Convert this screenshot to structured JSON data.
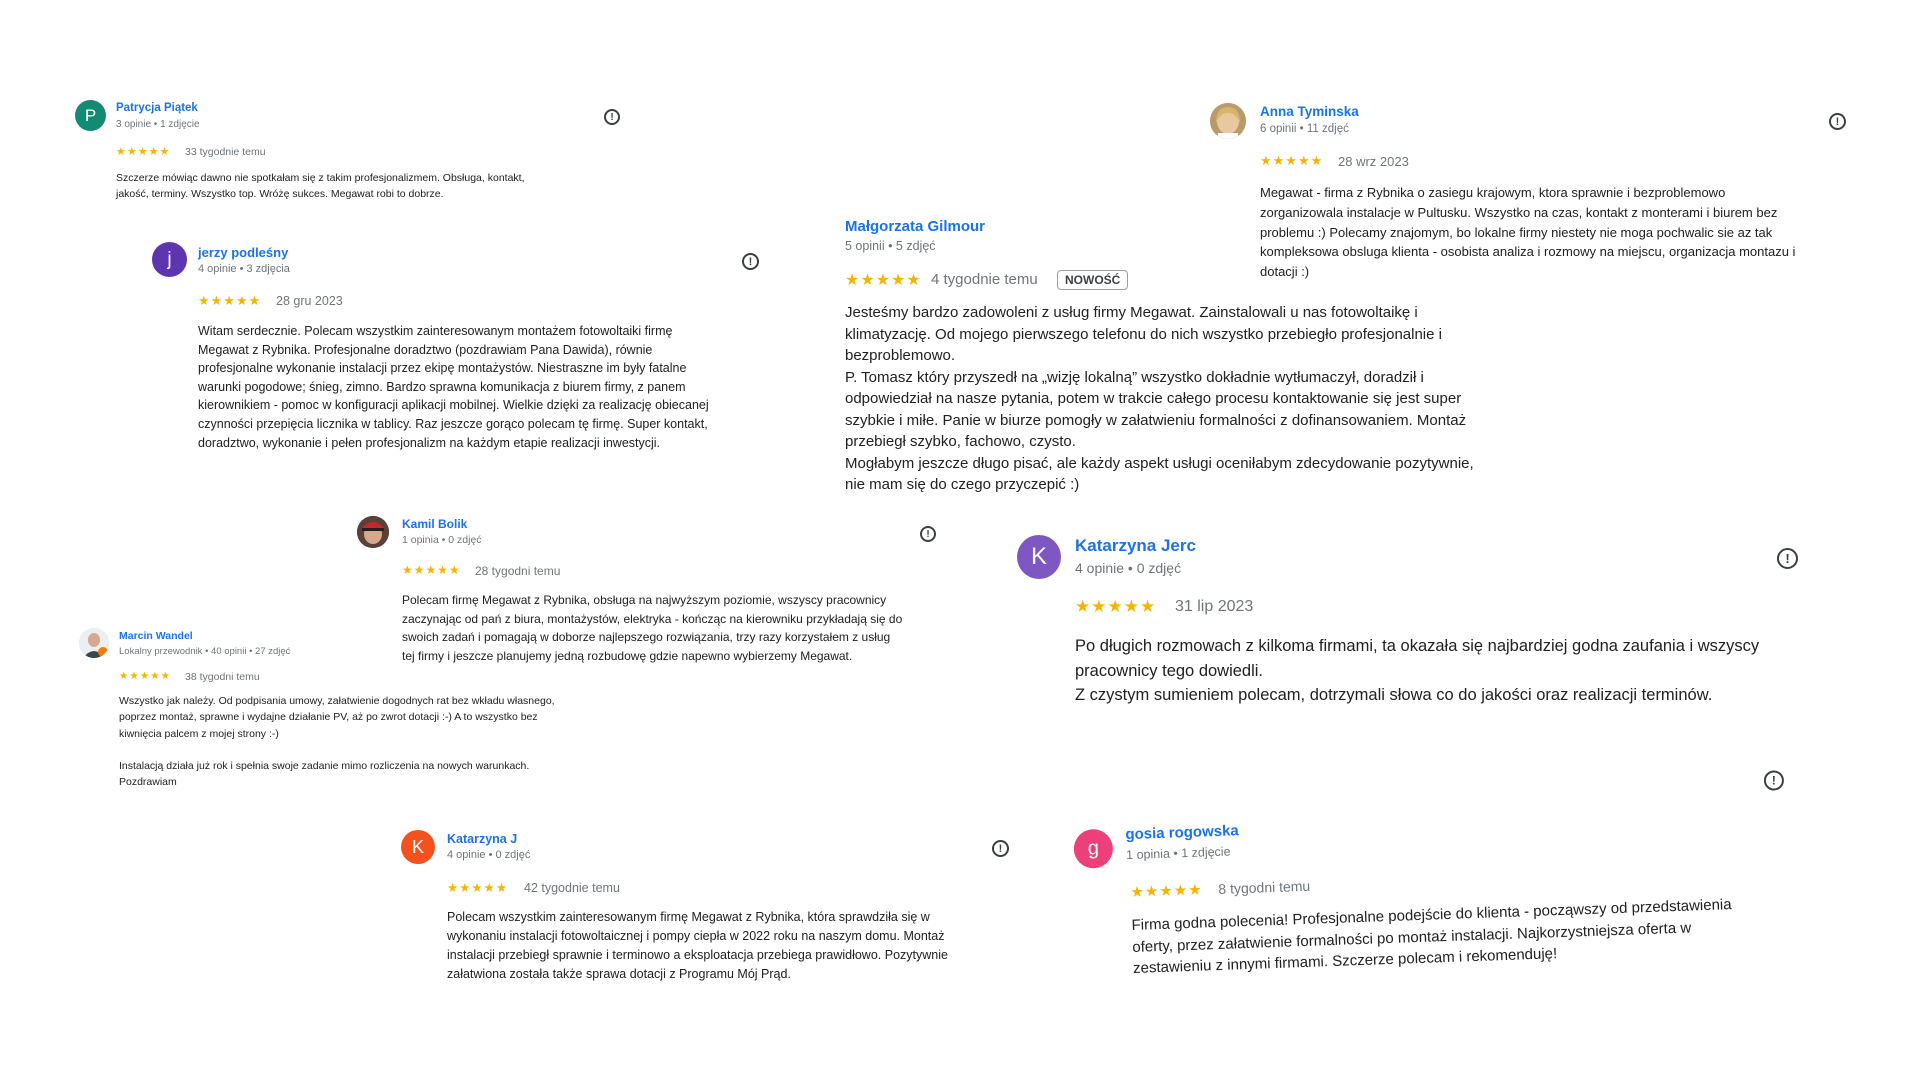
{
  "colors": {
    "link_name": "#1a73e8",
    "star": "#f5b400",
    "avatar_patrycja": "#138a74",
    "avatar_jerzy": "#5e35b1",
    "avatar_katarzyna_jerc": "#7e57c2",
    "avatar_katarzyna_j": "#f4511e",
    "avatar_gosia": "#ec407a"
  },
  "icons": {
    "report": "report-icon",
    "stars": "star-rating-icon"
  },
  "reviews": {
    "patrycja": {
      "initial": "P",
      "name": "Patrycja Piątek",
      "meta": "3 opinie • 1 zdjęcie",
      "rating": 5,
      "stars": "★★★★★",
      "date": "33 tygodnie temu",
      "text": "Szczerze mówiąc dawno nie spotkałam się z takim profesjonalizmem. Obsługa, kontakt,\njakość, terminy. Wszystko top. Wróżę sukces. Megawat robi to dobrze."
    },
    "jerzy": {
      "initial": "j",
      "name": "jerzy podleśny",
      "meta": "4 opinie • 3 zdjęcia",
      "rating": 5,
      "stars": "★★★★★",
      "date": "28 gru 2023",
      "text": "Witam serdecznie. Polecam wszystkim zainteresowanym montażem fotowoltaiki firmę\nMegawat z Rybnika. Profesjonalne doradztwo (pozdrawiam Pana Dawida), równie\nprofesjonalne wykonanie instalacji przez ekipę montażystów. Niestraszne im były fatalne\nwarunki pogodowe; śnieg, zimno. Bardzo sprawna komunikacja z biurem firmy, z panem\nkierownikiem - pomoc w konfiguracji aplikacji mobilnej. Wielkie dzięki za realizację obiecanej\nczynności przepięcia licznika w tablicy. Raz jeszcze gorąco polecam tę firmę. Super kontakt,\ndoradztwo, wykonanie i pełen profesjonalizm na każdym etapie realizacji inwestycji."
    },
    "malgorzata": {
      "name": "Małgorzata Gilmour",
      "meta": "5 opinii • 5 zdjęć",
      "rating": 5,
      "stars": "★★★★★",
      "date": "4 tygodnie temu",
      "badge": "NOWOŚĆ",
      "text": "Jesteśmy bardzo zadowoleni z usług firmy Megawat. Zainstalowali u nas fotowoltaikę i\nklimatyzację. Od mojego pierwszego telefonu do nich wszystko przebiegło profesjonalnie i\nbezproblemowo.\nP. Tomasz który przyszedł na „wizję lokalną” wszystko dokładnie wytłumaczył, doradził i\nodpowiedział na nasze pytania, potem w trakcie całego procesu kontaktowanie się jest super\nszybkie i miłe. Panie w biurze pomogły w załatwieniu formalności z dofinansowaniem. Montaż\nprzebiegł szybko, fachowo, czysto.\nMogłabym jeszcze długo pisać, ale każdy aspekt usługi oceniłabym zdecydowanie pozytywnie,\nnie mam się do czego przyczepić :)"
    },
    "anna": {
      "name": "Anna Tyminska",
      "meta": "6 opinii • 11 zdjęć",
      "rating": 5,
      "stars": "★★★★★",
      "date": "28 wrz 2023",
      "text": "Megawat - firma z Rybnika o zasiegu krajowym, ktora sprawnie i bezproblemowo\nzorganizowala instalacje w Pultusku. Wszystko na czas, kontakt z monterami i biurem bez\nproblemu :) Polecamy znajomym, bo lokalne firmy niestety nie moga pochwalic sie az tak\nkompleksowa obsluga klienta - osobista analiza i rozmowy na miejscu, organizacja montazu i\ndotacji :)"
    },
    "kamil": {
      "name": "Kamil Bolik",
      "meta": "1 opinia • 0 zdjęć",
      "rating": 5,
      "stars": "★★★★★",
      "date": "28 tygodni temu",
      "text": "Polecam firmę Megawat z Rybnika, obsługa na najwyższym poziomie, wszyscy pracownicy\nzaczynając od pań z biura, montażystów, elektryka - kończąc na kierowniku przykładają się do\nswoich zadań i pomagają w doborze najlepszego rozwiązania, trzy razy korzystałem z usług\ntej firmy i jeszcze planujemy jedną rozbudowę gdzie napewno wybierzemy Megawat."
    },
    "marcin": {
      "name": "Marcin Wandel",
      "meta": "Lokalny przewodnik • 40 opinii • 27 zdjęć",
      "rating": 5,
      "stars": "★★★★★",
      "date": "38 tygodni temu",
      "text": "Wszystko jak należy. Od podpisania umowy, załatwienie dogodnych rat bez wkładu własnego,\npoprzez montaż, sprawne i wydajne działanie PV, aż po zwrot dotacji :-) A to wszystko bez\nkiwnięcia palcem z mojej strony :-)\n\nInstalacją działa już rok i spełnia swoje zadanie mimo rozliczenia na nowych warunkach.\nPozdrawiam"
    },
    "katarzyna_jerc": {
      "initial": "K",
      "name": "Katarzyna Jerc",
      "meta": "4 opinie • 0 zdjęć",
      "rating": 5,
      "stars": "★★★★★",
      "date": "31 lip 2023",
      "text": "Po długich rozmowach z kilkoma firmami, ta okazała się najbardziej godna zaufania i wszyscy\npracownicy tego dowiedli.\nZ czystym sumieniem polecam, dotrzymali słowa co do jakości oraz realizacji terminów."
    },
    "katarzyna_j": {
      "initial": "K",
      "name": "Katarzyna J",
      "meta": "4 opinie • 0 zdjęć",
      "rating": 5,
      "stars": "★★★★★",
      "date": "42 tygodnie temu",
      "text": "Polecam wszystkim zainteresowanym firmę Megawat z Rybnika, która sprawdziła się w\nwykonaniu instalacji fotowoltaicznej i pompy ciepła w 2022 roku na naszym domu. Montaż\ninstalacji przebiegł sprawnie i terminowo a eksploatacja przebiega prawidłowo. Pozytywnie\nzałatwiona została także sprawa dotacji z Programu Mój Prąd."
    },
    "gosia": {
      "initial": "g",
      "name": "gosia rogowska",
      "meta": "1 opinia • 1 zdjęcie",
      "rating": 5,
      "stars": "★★★★★",
      "date": "8 tygodni temu",
      "text": "Firma godna polecenia! Profesjonalne podejście do klienta - począwszy od przedstawienia\noferty, przez załatwienie formalności po montaż instalacji. Najkorzystniejsza oferta w\nzestawieniu z innymi firmami. Szczerze polecam i rekomenduję!"
    }
  }
}
